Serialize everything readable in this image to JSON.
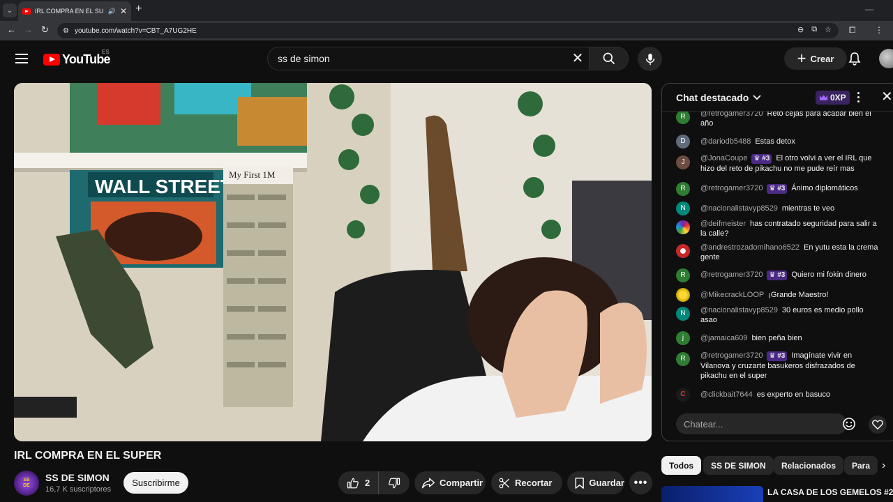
{
  "browser": {
    "tab_title": "IRL COMPRA EN EL SUPER",
    "url": "youtube.com/watch?v=CBT_A7UG2HE"
  },
  "header": {
    "logo_text": "YouTube",
    "region": "ES",
    "search_query": "ss de simon",
    "create_label": "Crear"
  },
  "video": {
    "title": "IRL COMPRA EN EL SUPER",
    "channel_name": "SS DE SIMON",
    "subscribers": "16,7 K suscriptores",
    "subscribe_label": "Suscribirme",
    "like_count": "2",
    "share_label": "Compartir",
    "clip_label": "Recortar",
    "save_label": "Guardar",
    "scene_wall_sign": "WALL STREET",
    "scene_frame_label": "My First 1M"
  },
  "chat": {
    "title": "Chat destacado",
    "xp_badge": "0XP",
    "input_placeholder": "Chatear...",
    "messages": [
      {
        "author": "@retrogamer3720",
        "badge": "",
        "text": "Reto cejas para acabar bien el año",
        "avatar_letter": "R",
        "avatar_color": "#2e7d32"
      },
      {
        "author": "@dariodb5488",
        "badge": "",
        "text": "Estas detox",
        "avatar_letter": "D",
        "avatar_color": "#5f6b7a"
      },
      {
        "author": "@JonaCoupe",
        "badge": "#3",
        "text": "El otro volvi a ver el IRL que hizo del reto de pikachu no me pude reír mas",
        "avatar_letter": "J",
        "avatar_color": "#6d4c41"
      },
      {
        "author": "@retrogamer3720",
        "badge": "#3",
        "text": "Ánimo diplomáticos",
        "avatar_letter": "R",
        "avatar_color": "#2e7d32"
      },
      {
        "author": "@nacionalistavyp8529",
        "badge": "",
        "text": "mientras te veo",
        "avatar_letter": "N",
        "avatar_color": "#00897b"
      },
      {
        "author": "@deifmeister",
        "badge": "",
        "text": "has contratado seguridad para salir a la calle?",
        "avatar_letter": "",
        "avatar_color": "#7b1fa2"
      },
      {
        "author": "@andrestrozadomihano6522",
        "badge": "",
        "text": "En yutu esta la crema gente",
        "avatar_letter": "",
        "avatar_color": "#c62828"
      },
      {
        "author": "@retrogamer3720",
        "badge": "#3",
        "text": "Quiero mi fokin dinero",
        "avatar_letter": "R",
        "avatar_color": "#2e7d32"
      },
      {
        "author": "@MikecrackLOOP",
        "badge": "",
        "text": "¡Grande Maestro!",
        "avatar_letter": "",
        "avatar_color": "#c0a000"
      },
      {
        "author": "@nacionalistavyp8529",
        "badge": "",
        "text": "30 euros es medio pollo asao",
        "avatar_letter": "N",
        "avatar_color": "#00897b"
      },
      {
        "author": "@jamaica609",
        "badge": "",
        "text": "bien peña bien",
        "avatar_letter": "j",
        "avatar_color": "#2e7d32"
      },
      {
        "author": "@retrogamer3720",
        "badge": "#3",
        "text": "Imagínate vivir en Vilanova y cruzarte basukeros disfrazados de pikachu en el super",
        "avatar_letter": "R",
        "avatar_color": "#2e7d32"
      },
      {
        "author": "@clickbait7644",
        "badge": "",
        "text": "es experto en basuco",
        "avatar_letter": "C",
        "avatar_color": "#1a1a1a"
      }
    ]
  },
  "chips": [
    "Todos",
    "SS DE SIMON",
    "Relacionados",
    "Para"
  ],
  "suggestion": {
    "title": "LA CASA DE LOS GEMELOS #2 |"
  }
}
